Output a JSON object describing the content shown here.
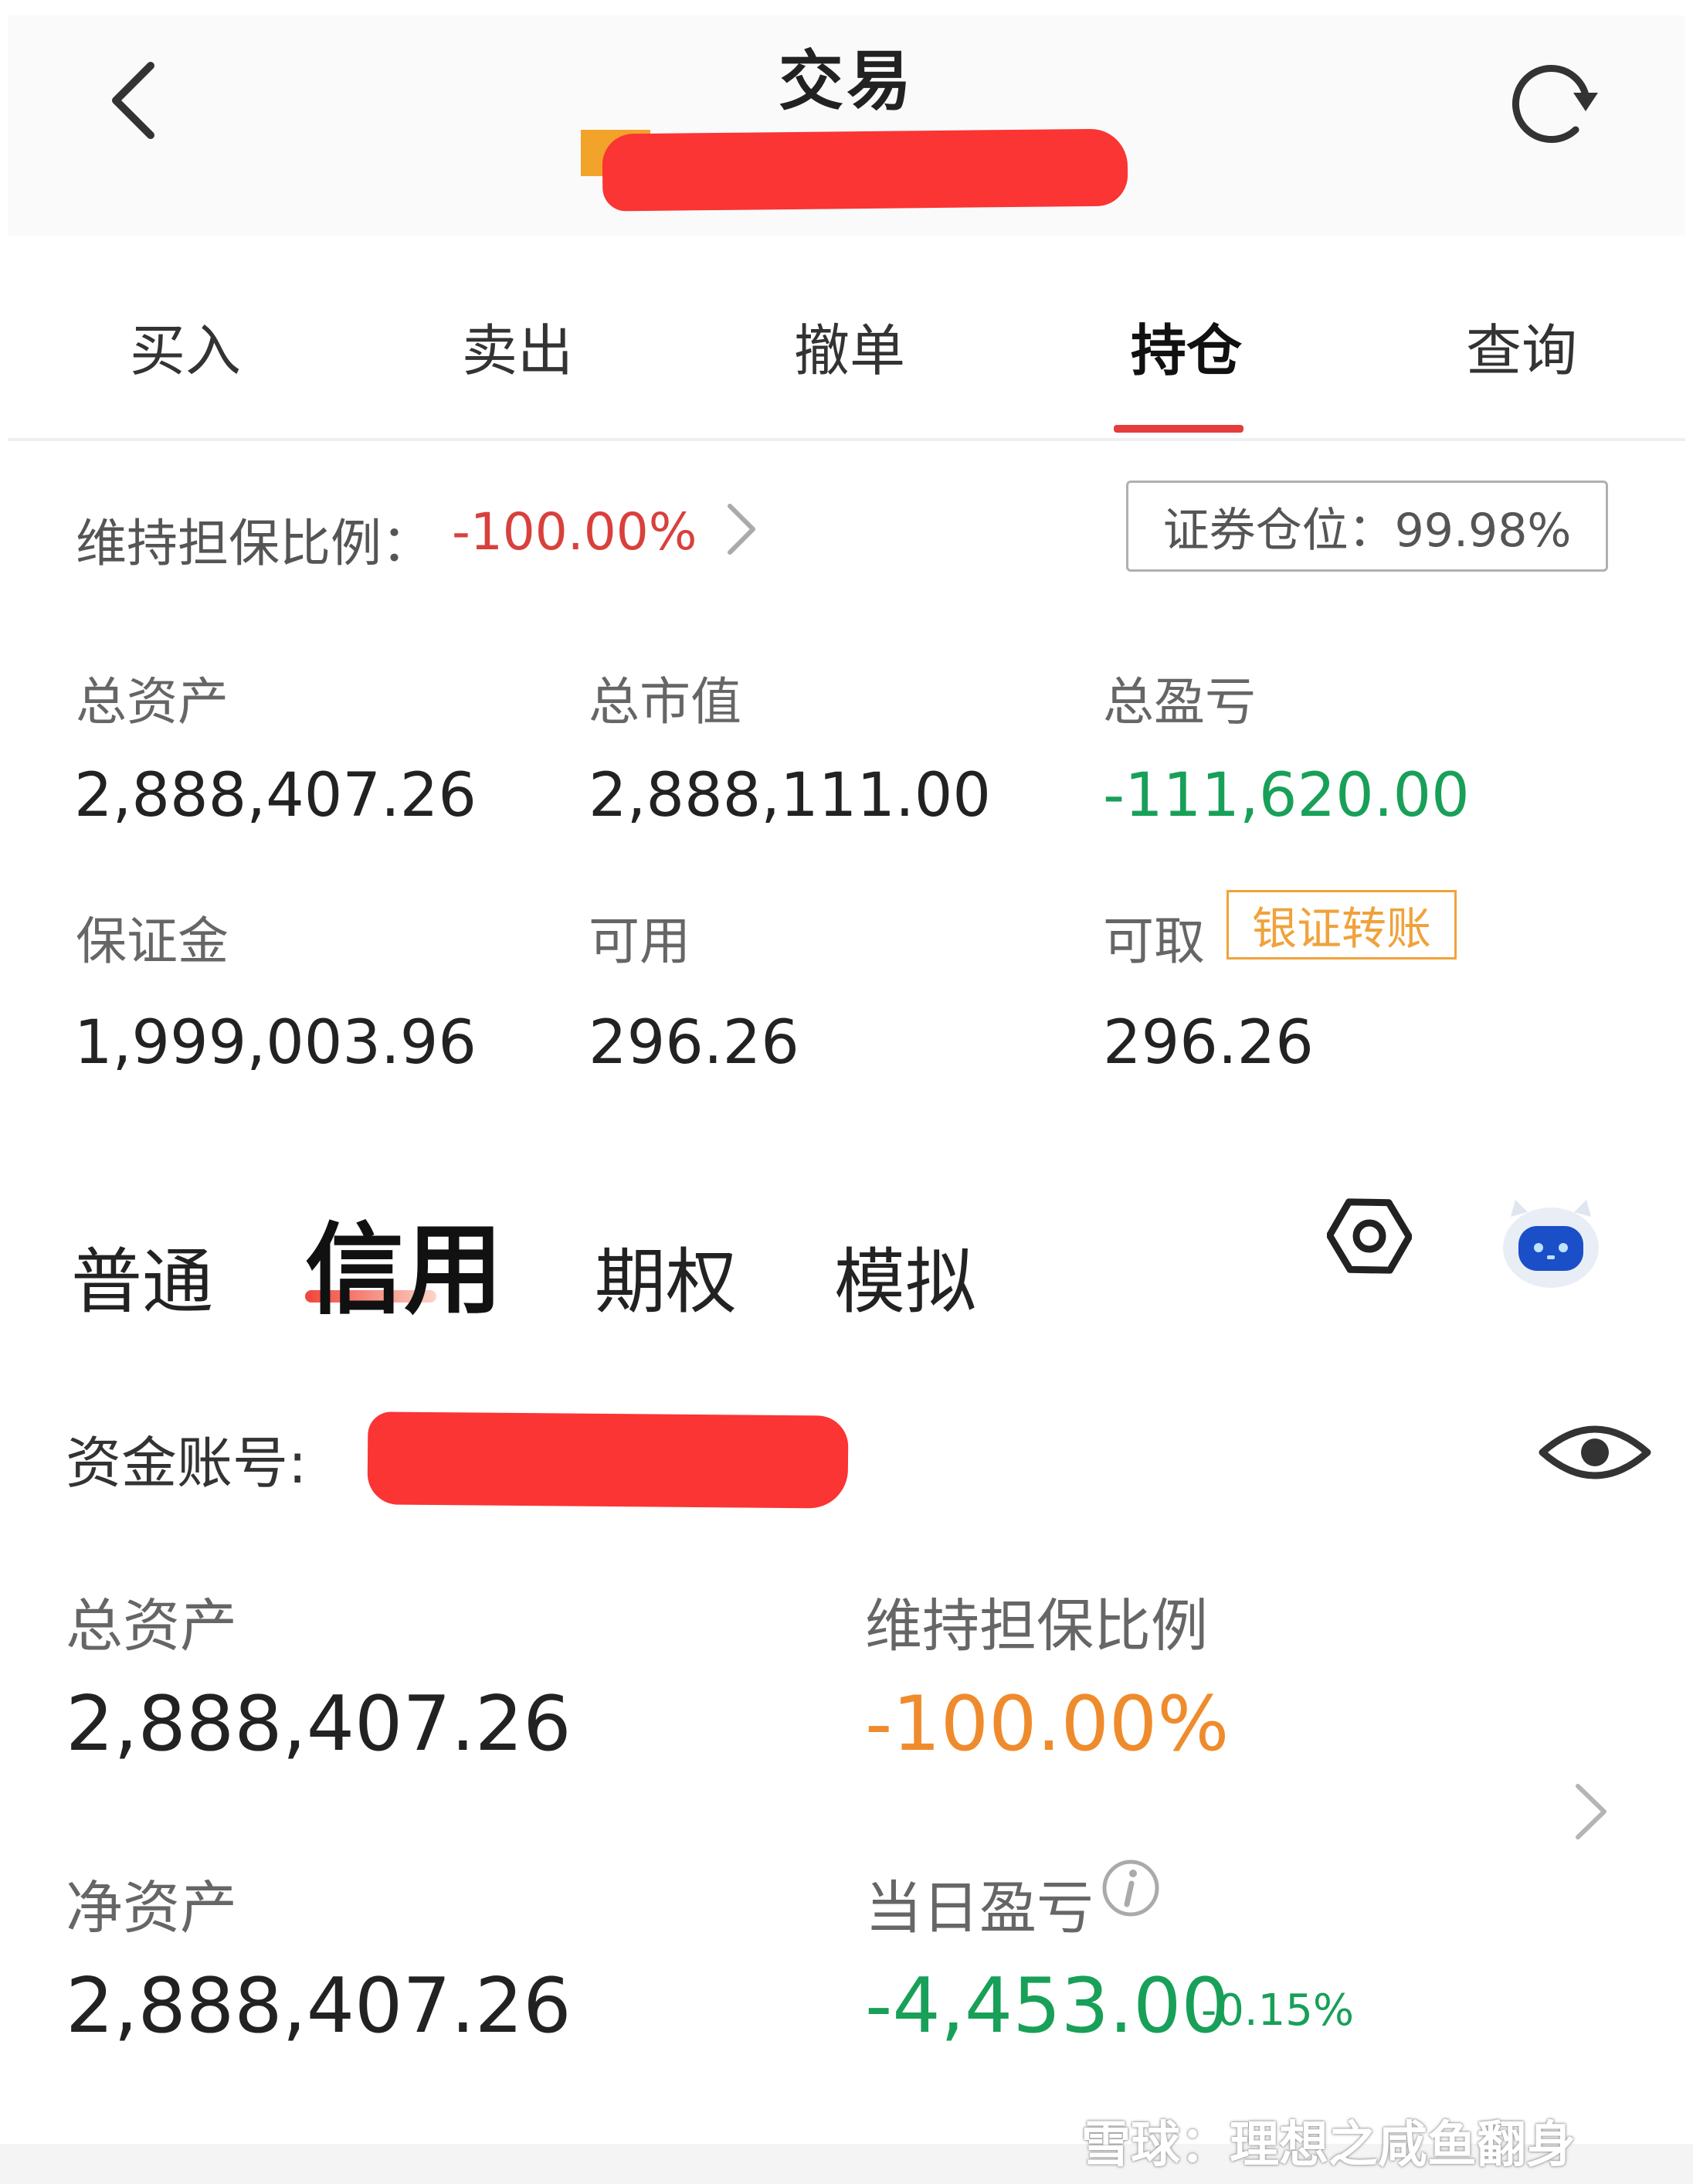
{
  "header": {
    "title": "交易",
    "back_icon": "chevron-left-icon",
    "refresh_icon": "refresh-icon"
  },
  "trade_tabs": [
    "买入",
    "卖出",
    "撤单",
    "持仓",
    "查询"
  ],
  "active_trade_tab": "持仓",
  "margin_summary": {
    "maintenance_label": "维持担保比例：",
    "maintenance_value": "-100.00%",
    "position_ratio": "证券仓位：99.98%",
    "total_assets_label": "总资产",
    "total_assets": "2,888,407.26",
    "total_market_value_label": "总市值",
    "total_market_value": "2,888,111.00",
    "total_pnl_label": "总盈亏",
    "total_pnl": "-111,620.00",
    "deposit_label": "保证金",
    "deposit": "1,999,003.96",
    "available_label": "可用",
    "available": "296.26",
    "withdrawable_label": "可取",
    "withdrawable": "296.26",
    "transfer_button": "银证转账"
  },
  "account_types": [
    "普通",
    "信用",
    "期权",
    "模拟"
  ],
  "active_account_type": "信用",
  "account": {
    "fund_account_label": "资金账号:",
    "total_assets_label": "总资产",
    "total_assets": "2,888,407.26",
    "maintenance_label": "维持担保比例",
    "maintenance_value": "-100.00%",
    "net_assets_label": "净资产",
    "net_assets": "2,888,407.26",
    "daily_pnl_label": "当日盈亏",
    "daily_pnl": "-4,453.00",
    "daily_pnl_pct": "-0.15%"
  },
  "watermark": "雪球：理想之咸鱼翻身",
  "colors": {
    "accent_red": "#e63c3c",
    "loss_green": "#18a058",
    "orange": "#ef8b2c",
    "transfer_orange": "#f0a23b"
  }
}
